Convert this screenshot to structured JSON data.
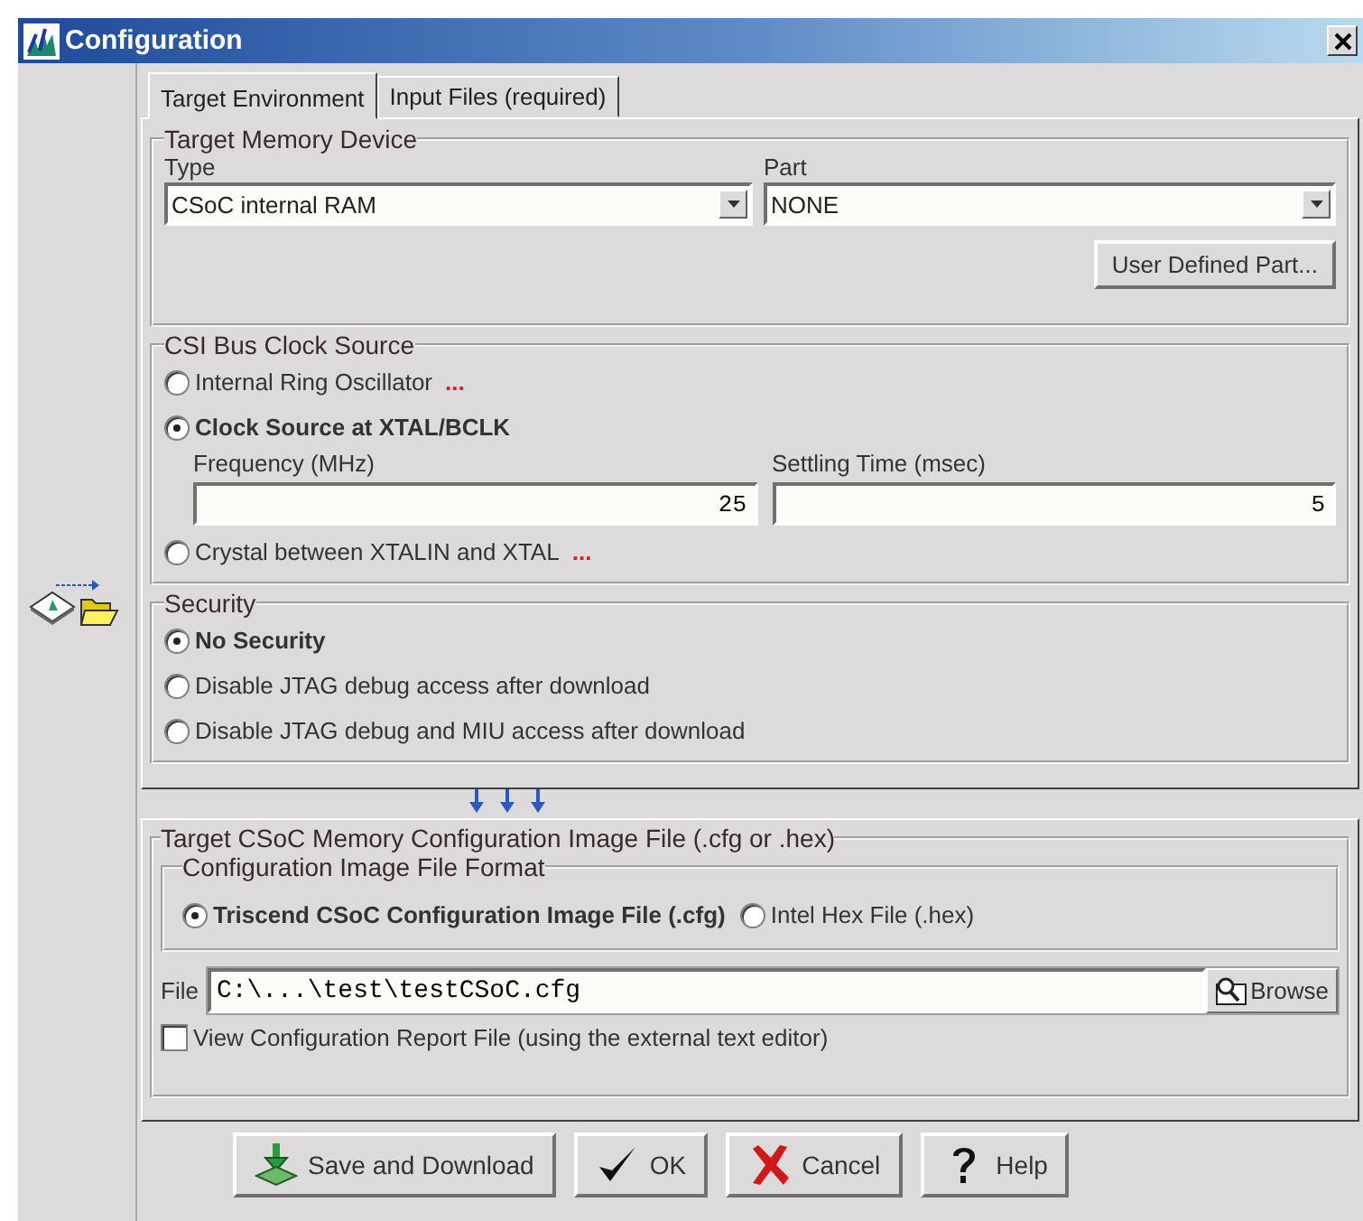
{
  "window": {
    "title": "Configuration"
  },
  "tabs": [
    {
      "label": "Target Environment",
      "selected": true
    },
    {
      "label": "Input Files (required)",
      "selected": false
    }
  ],
  "memory_device": {
    "title": "Target Memory Device",
    "type": {
      "label": "Type",
      "value": "CSoC internal RAM"
    },
    "part": {
      "label": "Part",
      "value": "NONE"
    },
    "user_defined_button": "User Defined Part..."
  },
  "clock_source": {
    "title": "CSI Bus Clock Source",
    "options": [
      {
        "label": "Internal Ring Oscillator",
        "more": "...",
        "selected": false
      },
      {
        "label": "Clock Source at XTAL/BCLK",
        "selected": true,
        "fields": [
          {
            "label": "Frequency (MHz)",
            "value": "25"
          },
          {
            "label": "Settling Time (msec)",
            "value": "5"
          }
        ]
      },
      {
        "label": "Crystal between XTALIN and XTAL",
        "more": "...",
        "selected": false
      }
    ]
  },
  "security": {
    "title": "Security",
    "options": [
      {
        "label": "No Security",
        "selected": true
      },
      {
        "label": "Disable JTAG debug access after download",
        "selected": false
      },
      {
        "label": "Disable JTAG debug and MIU access after download",
        "selected": false
      }
    ]
  },
  "image_file": {
    "title": "Target CSoC Memory Configuration Image File (.cfg or .hex)",
    "format": {
      "title": "Configuration Image File Format",
      "options": [
        {
          "label": "Triscend CSoC Configuration Image File (.cfg)",
          "selected": true
        },
        {
          "label": "Intel Hex File (.hex)",
          "selected": false
        }
      ]
    },
    "file": {
      "label": "File",
      "value": "C:\\...\\test\\testCSoC.cfg",
      "browse": "Browse"
    },
    "view_report": {
      "label": "View Configuration Report File (using the external text editor)",
      "checked": false
    }
  },
  "buttons": [
    {
      "label": "Save and Download",
      "kind": "save"
    },
    {
      "label": "OK",
      "kind": "ok"
    },
    {
      "label": "Cancel",
      "kind": "cancel"
    },
    {
      "label": "Help",
      "kind": "help"
    }
  ]
}
